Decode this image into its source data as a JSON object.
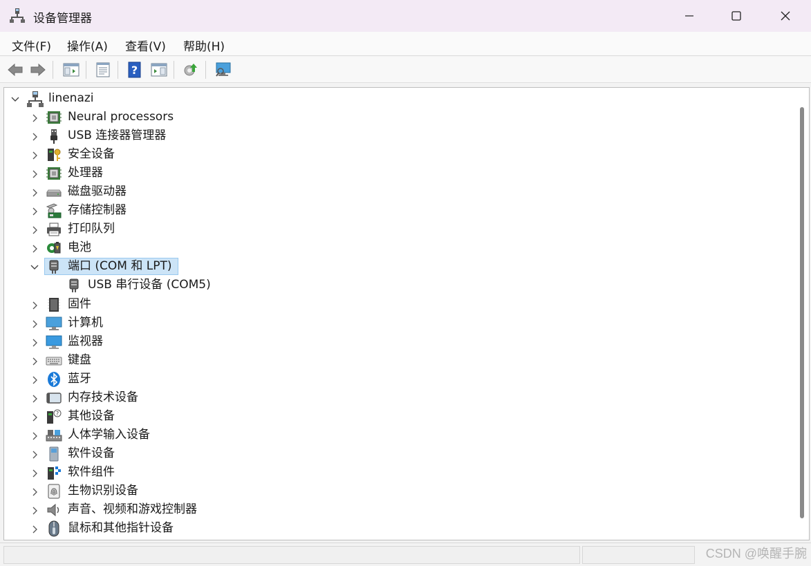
{
  "window": {
    "title": "设备管理器",
    "icon": "device-manager-icon"
  },
  "menu": {
    "items": [
      "文件(F)",
      "操作(A)",
      "查看(V)",
      "帮助(H)"
    ]
  },
  "toolbar": {
    "buttons": [
      "back-arrow-icon",
      "forward-arrow-icon",
      "show-hide-console-tree-icon",
      "properties-icon",
      "help-icon",
      "action-pane-icon",
      "update-driver-icon",
      "scan-hardware-changes-icon"
    ]
  },
  "tree": {
    "root": "linenazi",
    "categories": [
      {
        "label": "Neural processors",
        "icon": "processor-chip-icon"
      },
      {
        "label": "USB 连接器管理器",
        "icon": "usb-connector-icon"
      },
      {
        "label": "安全设备",
        "icon": "security-key-icon"
      },
      {
        "label": "处理器",
        "icon": "processor-chip-icon"
      },
      {
        "label": "磁盘驱动器",
        "icon": "disk-drive-icon"
      },
      {
        "label": "存储控制器",
        "icon": "storage-controller-icon"
      },
      {
        "label": "打印队列",
        "icon": "printer-icon"
      },
      {
        "label": "电池",
        "icon": "battery-icon"
      },
      {
        "label": "端口 (COM 和 LPT)",
        "icon": "port-icon",
        "expanded": true,
        "selected": true
      },
      {
        "label": "固件",
        "icon": "firmware-icon"
      },
      {
        "label": "计算机",
        "icon": "computer-icon"
      },
      {
        "label": "监视器",
        "icon": "monitor-icon"
      },
      {
        "label": "键盘",
        "icon": "keyboard-icon"
      },
      {
        "label": "蓝牙",
        "icon": "bluetooth-icon"
      },
      {
        "label": "内存技术设备",
        "icon": "memory-device-icon"
      },
      {
        "label": "其他设备",
        "icon": "unknown-device-icon"
      },
      {
        "label": "人体学输入设备",
        "icon": "hid-icon"
      },
      {
        "label": "软件设备",
        "icon": "software-device-icon"
      },
      {
        "label": "软件组件",
        "icon": "software-component-icon"
      },
      {
        "label": "生物识别设备",
        "icon": "fingerprint-icon"
      },
      {
        "label": "声音、视频和游戏控制器",
        "icon": "speaker-icon"
      },
      {
        "label": "鼠标和其他指针设备",
        "icon": "mouse-icon"
      }
    ],
    "port_child": "USB 串行设备 (COM5)"
  },
  "watermark": "CSDN @唤醒手腕"
}
